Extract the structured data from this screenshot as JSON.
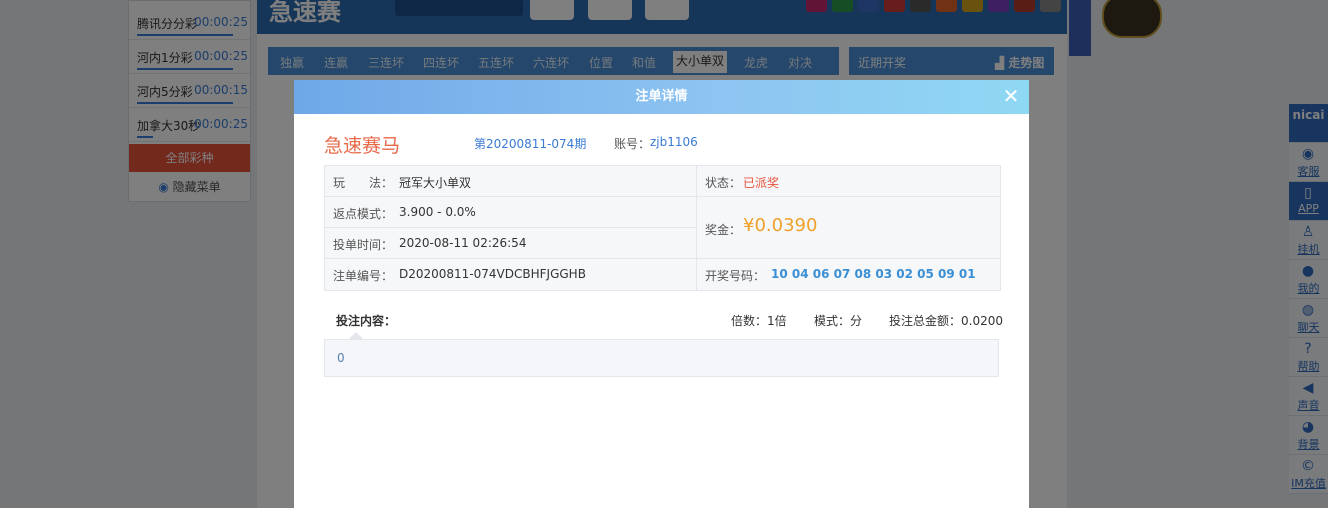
{
  "left_menu": {
    "items": [
      {
        "name": "腾讯分分彩",
        "time": "00:00:25"
      },
      {
        "name": "河内1分彩",
        "time": "00:00:25"
      },
      {
        "name": "河内5分彩",
        "time": "00:00:15"
      },
      {
        "name": "加拿大30秒",
        "time": "00:00:25"
      }
    ],
    "all_label": "全部彩种",
    "hide_label": "隐藏菜单"
  },
  "tabs": [
    "独赢",
    "连赢",
    "三连坏",
    "四连坏",
    "五连坏",
    "六连坏",
    "位置",
    "和值",
    "大小单双",
    "龙虎",
    "对决"
  ],
  "active_tab": "大小单双",
  "recent": {
    "title": "近期开奖",
    "trend": "走势图"
  },
  "sidebar": [
    "客服",
    "APP",
    "挂机",
    "我的",
    "聊天",
    "帮助",
    "声音",
    "背景",
    "IM充值"
  ],
  "sidebar_logo": "nicai",
  "modal": {
    "title": "注单详情",
    "game_name": "急速赛马",
    "issue": "第20200811-074期",
    "account_label": "账号：",
    "account": "zjb1106",
    "play_label": "玩　　法：",
    "play_value": "冠军大小单双",
    "status_label": "状态：",
    "status_value": "已派奖",
    "rebate_label": "返点模式：",
    "rebate_value": "3.900 - 0.0%",
    "time_label": "投单时间：",
    "time_value": "2020-08-11 02:26:54",
    "prize_label": "奖金：",
    "prize_value": "¥0.0390",
    "order_label": "注单编号：",
    "order_value": "D20200811-074VDCBHFJGGHB",
    "draw_label": "开奖号码：",
    "draw_numbers": "10 04 06 07 08 03 02 05 09 01",
    "bet_content_label": "投注内容：",
    "multiple": "倍数：1倍",
    "mode": "模式：分",
    "total": "投注总金额：0.0200",
    "bet_content": "0"
  },
  "colors": {
    "accent": "#3a7bd5",
    "orange": "#e8694a",
    "prize": "#f0a02a",
    "status": "#e8533b"
  }
}
